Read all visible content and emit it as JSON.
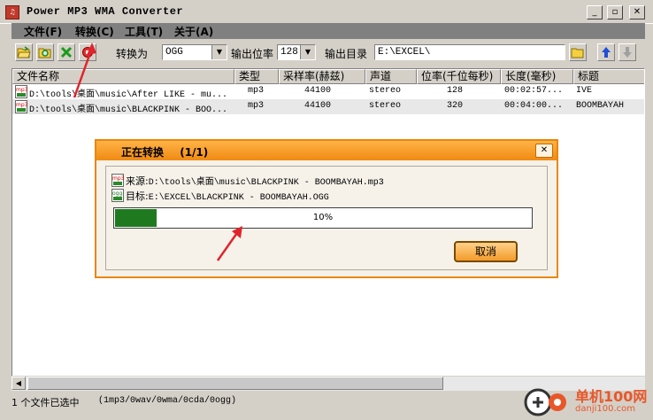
{
  "window": {
    "title": "Power MP3 WMA Converter"
  },
  "menu": [
    "文件(F)",
    "转换(C)",
    "工具(T)",
    "关于(A)"
  ],
  "toolbar": {
    "convert_to_label": "转换为",
    "format_value": "OGG",
    "bitrate_label": "输出位率",
    "bitrate_value": "128",
    "output_dir_label": "输出目录",
    "output_dir_value": "E:\\EXCEL\\"
  },
  "list": {
    "columns": [
      "文件名称",
      "类型",
      "采样率(赫兹)",
      "声道",
      "位率(千位每秒)",
      "长度(毫秒)",
      "标题"
    ],
    "rows": [
      {
        "file": "D:\\tools\\桌面\\music\\After LIKE - mu...",
        "type": "mp3",
        "sample_rate": "44100",
        "channels": "stereo",
        "bitrate": "128",
        "length": "00:02:57...",
        "title": "IVE"
      },
      {
        "file": "D:\\tools\\桌面\\music\\BLACKPINK - BOO...",
        "type": "mp3",
        "sample_rate": "44100",
        "channels": "stereo",
        "bitrate": "320",
        "length": "00:04:00...",
        "title": "BOOMBAYAH"
      }
    ]
  },
  "status": {
    "selected": "1 个文件已选中",
    "formats": "(1mp3/0wav/0wma/0cda/0ogg)"
  },
  "dialog": {
    "title": "正在转换",
    "count": "(1/1)",
    "source_label": "来源:",
    "source_path": "D:\\tools\\桌面\\music\\BLACKPINK - BOOMBAYAH.mp3",
    "target_label": "目标:",
    "target_path": "E:\\EXCEL\\BLACKPINK - BOOMBAYAH.OGG",
    "progress": 0.1,
    "progress_text": "10%",
    "cancel_label": "取消"
  },
  "icons": {
    "mp3": "mp3-file-icon",
    "ogg": "ogg-file-icon",
    "open": "open-folder-icon",
    "search": "search-folder-icon",
    "remove": "remove-icon",
    "stop": "stop-icon",
    "browse": "folder-icon",
    "up": "arrow-up-icon",
    "down": "arrow-down-icon"
  },
  "colors": {
    "accent": "#f08a12",
    "progress": "#1f7a1f",
    "arrow": "#e0242b"
  },
  "watermark": {
    "text": "单机100网",
    "url": "danji100.com"
  }
}
